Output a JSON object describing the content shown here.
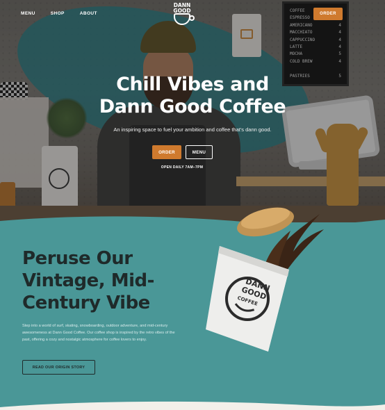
{
  "nav": {
    "links": [
      "MENU",
      "SHOP",
      "ABOUT"
    ],
    "order_label": "ORDER",
    "logo_text": [
      "DANN",
      "GOOD",
      "COFFEE"
    ]
  },
  "menu_board": {
    "rows": [
      {
        "item": "COFFEE",
        "price": "3"
      },
      {
        "item": "ESPRESSO",
        "price": "3"
      },
      {
        "item": "AMERICANO",
        "price": "4"
      },
      {
        "item": "MACCHIATO",
        "price": "4"
      },
      {
        "item": "CAPPUCCINO",
        "price": "4"
      },
      {
        "item": "LATTE",
        "price": "4"
      },
      {
        "item": "MOCHA",
        "price": "5"
      },
      {
        "item": "COLD BREW",
        "price": "4"
      },
      {
        "item": "",
        "price": ""
      },
      {
        "item": "PASTRIES",
        "price": "5"
      }
    ]
  },
  "hero": {
    "title_line1": "Chill Vibes and",
    "title_line2": "Dann Good Coffee",
    "subtitle": "An inspiring space to fuel your ambition and coffee that's dann good.",
    "order_button": "ORDER",
    "menu_button": "MENU",
    "hours": "OPEN DAILY 7AM–7PM"
  },
  "about": {
    "title_line1": "Peruse Our",
    "title_line2": "Vintage, Mid-",
    "title_line3": "Century Vibe",
    "body": "Step into a world of surf, skating, snowboarding, outdoor adventure, and mid-century awesomeness at Dann Good Coffee. Our coffee shop is inspired by the retro vibes of the past, offering a cozy and nostalgic atmosphere for coffee lovers to enjoy.",
    "button": "READ OUR ORIGIN STORY",
    "cup_text": [
      "DANN",
      "GOOD",
      "COFFEE"
    ]
  },
  "colors": {
    "accent_orange": "#cf7a2e",
    "teal": "#4a9797",
    "dark_text": "#1f2a2a",
    "cream": "#f3f0ea"
  }
}
